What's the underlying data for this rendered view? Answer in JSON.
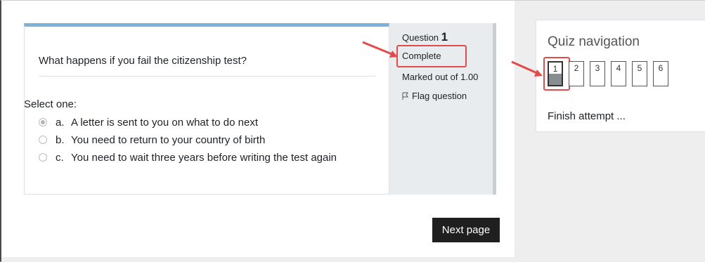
{
  "question": {
    "text": "What happens if you fail the citizenship test?",
    "prompt": "Select one:",
    "answers": [
      {
        "letter": "a.",
        "text": "A letter is sent to you on what to do next",
        "selected": true
      },
      {
        "letter": "b.",
        "text": "You need to return to your country of birth",
        "selected": false
      },
      {
        "letter": "c.",
        "text": "You need to wait three years before writing the test again",
        "selected": false
      }
    ]
  },
  "info": {
    "question_label": "Question",
    "question_number": "1",
    "state": "Complete",
    "grade": "Marked out of 1.00",
    "flag_label": "Flag question"
  },
  "next_button": "Next page",
  "quiz_nav": {
    "title": "Quiz navigation",
    "buttons": [
      "1",
      "2",
      "3",
      "4",
      "5",
      "6"
    ],
    "finish_label": "Finish attempt ..."
  },
  "colors": {
    "accent_bar": "#7ab3d6",
    "annotation_red": "#e24b4b",
    "button_dark": "#1f1f1f"
  },
  "icons": {
    "flag": "flag-icon"
  }
}
